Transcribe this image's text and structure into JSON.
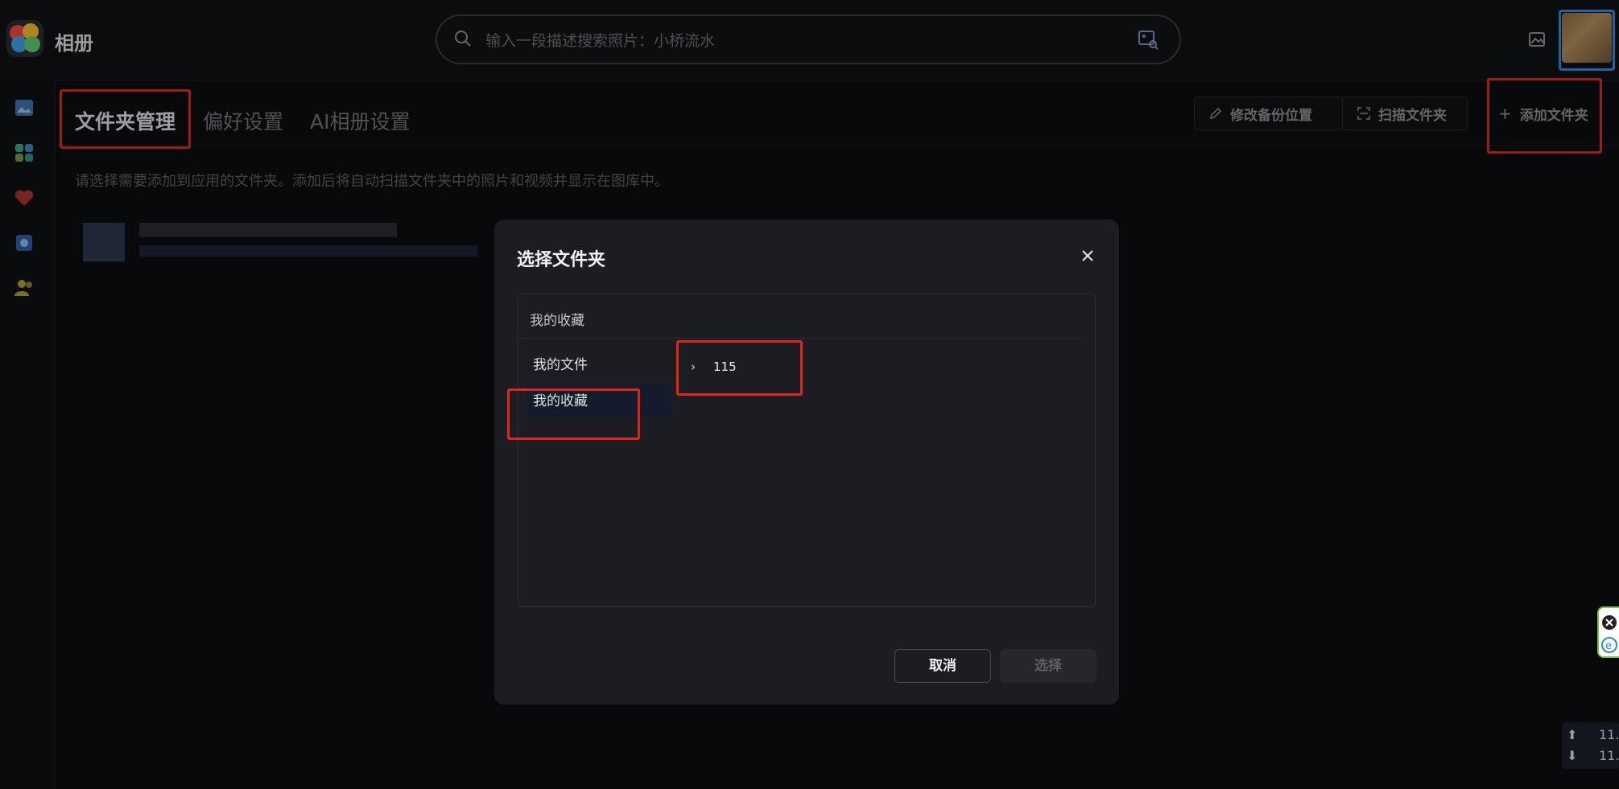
{
  "app": {
    "name": "相册"
  },
  "search": {
    "placeholder": "输入一段描述搜索照片：小桥流水"
  },
  "tabs": [
    {
      "label": "文件夹管理",
      "active": true
    },
    {
      "label": "偏好设置",
      "active": false
    },
    {
      "label": "AI相册设置",
      "active": false
    }
  ],
  "actions": {
    "edit_backup": "修改备份位置",
    "scan_folder": "扫描文件夹",
    "add_folder": "添加文件夹"
  },
  "description": "请选择需要添加到应用的文件夹。添加后将自动扫描文件夹中的照片和视频并显示在图库中。",
  "dialog": {
    "title": "选择文件夹",
    "breadcrumb": "我的收藏",
    "roots": [
      {
        "label": "我的文件",
        "selected": false
      },
      {
        "label": "我的收藏",
        "selected": true
      }
    ],
    "subfolders": [
      {
        "label": "115"
      }
    ],
    "cancel": "取消",
    "confirm": "选择"
  },
  "net_speed": {
    "up": "11.",
    "down": "11."
  },
  "colors": {
    "highlight_red": "#e0251b",
    "selected_bg": "#141b2d",
    "accent_blue": "#2f8be5"
  }
}
